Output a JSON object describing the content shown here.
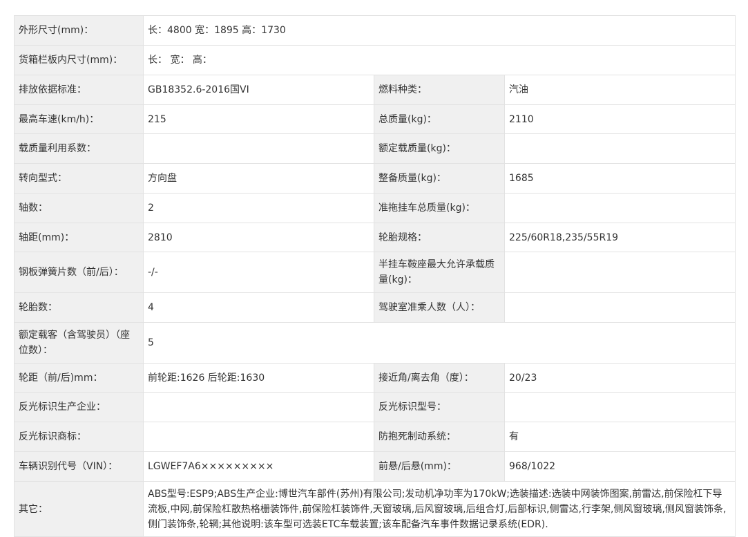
{
  "rows": [
    {
      "k1": "外形尺寸(mm)：",
      "v1": "长：4800 宽：1895 高：1730"
    },
    {
      "k1": "货箱栏板内尺寸(mm)：",
      "v1": "长：  宽：  高："
    },
    {
      "k1": "排放依据标准：",
      "v1": "GB18352.6-2016国VI",
      "k2": "燃料种类：",
      "v2": "汽油"
    },
    {
      "k1": "最高车速(km/h)：",
      "v1": "215",
      "k2": "总质量(kg)：",
      "v2": "2110"
    },
    {
      "k1": "载质量利用系数：",
      "v1": "",
      "k2": "额定载质量(kg)：",
      "v2": ""
    },
    {
      "k1": "转向型式：",
      "v1": "方向盘",
      "k2": "整备质量(kg)：",
      "v2": "1685"
    },
    {
      "k1": "轴数：",
      "v1": "2",
      "k2": "准拖挂车总质量(kg)：",
      "v2": ""
    },
    {
      "k1": "轴距(mm)：",
      "v1": "2810",
      "k2": "轮胎规格：",
      "v2": "225/60R18,235/55R19"
    },
    {
      "k1": "钢板弹簧片数（前/后）：",
      "v1": "-/-",
      "k2": "半挂车鞍座最大允许承载质量(kg)：",
      "v2": ""
    },
    {
      "k1": "轮胎数：",
      "v1": "4",
      "k2": "驾驶室准乘人数（人）：",
      "v2": ""
    },
    {
      "k1": "额定载客（含驾驶员）（座位数）：",
      "v1": "5"
    },
    {
      "k1": "轮距（前/后)mm：",
      "v1": "前轮距:1626 后轮距:1630",
      "k2": "接近角/离去角（度）：",
      "v2": "20/23"
    },
    {
      "k1": "反光标识生产企业：",
      "v1": "",
      "k2": "反光标识型号：",
      "v2": ""
    },
    {
      "k1": "反光标识商标：",
      "v1": "",
      "k2": "防抱死制动系统：",
      "v2": "有"
    },
    {
      "k1": "车辆识别代号（VIN）：",
      "v1": "LGWEF7A6×××××××××",
      "k2": "前悬/后悬(mm)：",
      "v2": "968/1022"
    },
    {
      "k1": "其它：",
      "v1": "ABS型号:ESP9;ABS生产企业:博世汽车部件(苏州)有限公司;发动机净功率为170kW;选装描述:选装中网装饰图案,前雷达,前保险杠下导流板,中网,前保险杠散热格栅装饰件,前保险杠装饰件,天窗玻璃,后风窗玻璃,后组合灯,后部标识,侧雷达,行李架,侧风窗玻璃,侧风窗装饰条,侧门装饰条,轮辋;其他说明:该车型可选装ETC车载装置;该车配备汽车事件数据记录系统(EDR)."
    }
  ]
}
